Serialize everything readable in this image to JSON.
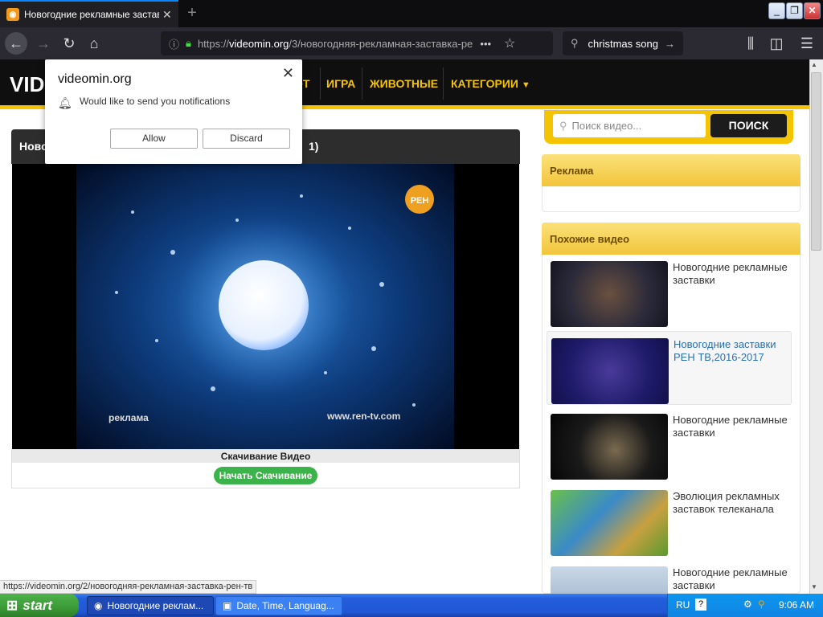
{
  "browser": {
    "tab_title": "Новогодние рекламные заставк",
    "tab_favicon": "videomin-favicon",
    "new_tab_label": "+",
    "url_host": "videomin.org",
    "url_prefix": "https://",
    "url_rest": "/3/новогодняя-рекламная-заставка-ре",
    "url_more": "•••",
    "search_query": "christmas song",
    "window_buttons": [
      "_",
      "❐",
      "✕"
    ]
  },
  "site": {
    "logo_text": "VIDE",
    "menu": [
      "ОТ",
      "ИГРА",
      "ЖИВОТНЫЕ",
      "КАТЕГОРИИ"
    ],
    "player_title": "Ново",
    "player_title_tail": "1)",
    "download_title": "Скачивание Видео",
    "download_button": "Начать Скачивание",
    "video_overlay_left": "реклама",
    "video_overlay_right": "www.ren-tv.com",
    "video_logo": "РЕН",
    "search_placeholder": "Поиск видео...",
    "search_button": "ПОИСК",
    "ad_heading": "Реклама",
    "related_heading": "Похожие видео",
    "related": [
      {
        "title": "Новогодние рекламные заставки"
      },
      {
        "title": "Новогодние заставки РЕН ТВ,2016-2017"
      },
      {
        "title": "Новогодние рекламные заставки"
      },
      {
        "title": "Эволюция рекламных заставок телеканала"
      },
      {
        "title": "Новогодние рекламные заставки"
      }
    ]
  },
  "status_link": "https://videomin.org/2/новогодняя-рекламная-заставка-рен-тв",
  "notification": {
    "site": "videomin.org",
    "message": "Would like to send you notifications",
    "allow": "Allow",
    "discard": "Discard"
  },
  "taskbar": {
    "start": "start",
    "tasks": [
      "Новогодние реклам...",
      "Date, Time, Languag..."
    ],
    "lang": "RU",
    "clock": "9:06 AM"
  },
  "colors": {
    "accent": "#f5c400",
    "download_green": "#3cb34a"
  }
}
